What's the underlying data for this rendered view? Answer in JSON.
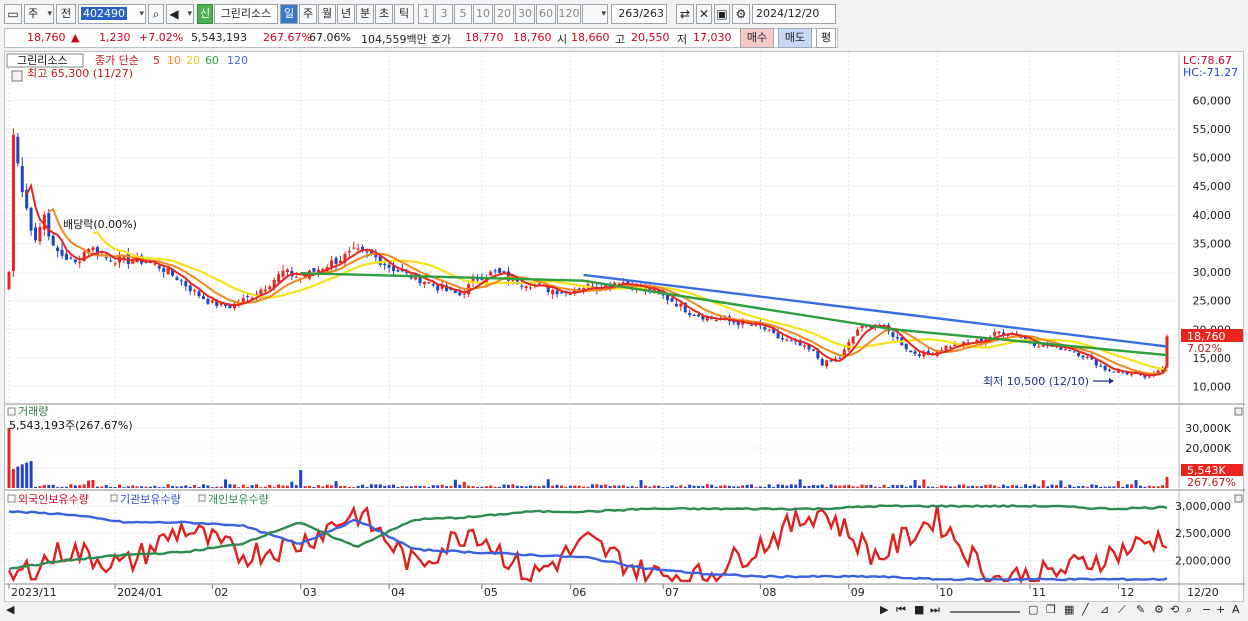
{
  "toolbar": {
    "market": "주",
    "prev": "전",
    "code": "402490",
    "badge": "신",
    "name": "그린리소스",
    "periods": [
      "일",
      "주",
      "월",
      "년",
      "분",
      "초",
      "틱"
    ],
    "active_period": "일",
    "intervals": [
      "1",
      "3",
      "5",
      "10",
      "20",
      "30",
      "60",
      "120"
    ],
    "count": "263",
    "count_total": "/263",
    "date": "2024/12/20"
  },
  "quote": {
    "price": "18,760",
    "direction": "▲",
    "change": "1,230",
    "change_pct": "+7.02%",
    "volume": "5,543,193",
    "volume_ratio": "267.67%",
    "turnover": "67.06%",
    "amount": "104,559백만",
    "ask_label": "호가",
    "ask1": "18,770",
    "ask2": "18,760",
    "open_label": "시",
    "open": "18,660",
    "high_label": "고",
    "high": "20,550",
    "low_label": "저",
    "low": "17,030",
    "buy": "매수",
    "sell": "매도",
    "avg": "평"
  },
  "price_panel": {
    "name_tag": "그린리소스",
    "ma_label": "종가 단순",
    "ma_periods": [
      "5",
      "10",
      "20",
      "60",
      "120"
    ],
    "high_note": "최고 65,300 (11/27)",
    "low_note": "최저 10,500 (12/10)",
    "dividend_note": "배당락(0.00%)",
    "lc": "LC:78.67",
    "hc": "HC:-71.27",
    "last_tag": "18,760",
    "last_pct": "7.02%"
  },
  "volume_panel": {
    "title": "거래량",
    "note": "5,543,193주(267.67%)",
    "last_tag": "5,543K",
    "last_pct": "267.67%"
  },
  "holding_panel": {
    "series_labels": [
      "외국인보유수량",
      "기관보유수량",
      "개인보유수량"
    ]
  },
  "colors": {
    "up": "#e8261f",
    "down": "#1d44c8",
    "ma5": "#e8261f",
    "ma10": "#f08a1c",
    "ma20": "#f5e21a",
    "ma60": "#2e9e3e",
    "ma120": "#3a6de0",
    "foreign": "#e0201c",
    "institution": "#3a62e0",
    "individual": "#2e8a4e"
  },
  "chart_data": [
    {
      "type": "candlestick",
      "title": "그린리소스",
      "y_ticks": [
        "10,000",
        "15,000",
        "20,000",
        "25,000",
        "30,000",
        "35,000",
        "40,000",
        "45,000",
        "50,000",
        "55,000",
        "60,000"
      ],
      "ylim": [
        8000,
        66000
      ],
      "x_ticks": [
        "2023/11",
        "2024/01",
        "02",
        "03",
        "04",
        "05",
        "06",
        "07",
        "08",
        "09",
        "10",
        "11",
        "12",
        "12/20"
      ],
      "close_path": [
        [
          0,
          30000
        ],
        [
          1,
          54000
        ],
        [
          2,
          49000
        ],
        [
          3,
          44000
        ],
        [
          4,
          41000
        ],
        [
          5,
          38000
        ],
        [
          6,
          36000
        ],
        [
          8,
          40000
        ],
        [
          10,
          34000
        ],
        [
          12,
          33000
        ],
        [
          15,
          31500
        ],
        [
          18,
          34500
        ],
        [
          22,
          32500
        ],
        [
          26,
          32000
        ],
        [
          30,
          32000
        ],
        [
          34,
          31000
        ],
        [
          38,
          29000
        ],
        [
          42,
          26500
        ],
        [
          46,
          24500
        ],
        [
          50,
          24000
        ],
        [
          54,
          25500
        ],
        [
          58,
          27500
        ],
        [
          62,
          30000
        ],
        [
          66,
          29000
        ],
        [
          70,
          30500
        ],
        [
          74,
          32000
        ],
        [
          78,
          33500
        ],
        [
          82,
          33000
        ],
        [
          86,
          31000
        ],
        [
          90,
          29500
        ],
        [
          94,
          28500
        ],
        [
          98,
          27000
        ],
        [
          102,
          26000
        ],
        [
          106,
          29000
        ],
        [
          110,
          30000
        ],
        [
          114,
          28500
        ],
        [
          118,
          28000
        ],
        [
          122,
          27000
        ],
        [
          126,
          26500
        ],
        [
          130,
          27500
        ],
        [
          134,
          27500
        ],
        [
          138,
          28500
        ],
        [
          142,
          27500
        ],
        [
          146,
          26500
        ],
        [
          150,
          25000
        ],
        [
          154,
          23000
        ],
        [
          158,
          22000
        ],
        [
          162,
          21500
        ],
        [
          166,
          21000
        ],
        [
          170,
          20500
        ],
        [
          174,
          18500
        ],
        [
          178,
          17500
        ],
        [
          182,
          16000
        ],
        [
          184,
          14000
        ],
        [
          188,
          15000
        ],
        [
          192,
          20000
        ],
        [
          196,
          21000
        ],
        [
          200,
          19000
        ],
        [
          204,
          16000
        ],
        [
          208,
          15500
        ],
        [
          212,
          17000
        ],
        [
          216,
          17500
        ],
        [
          220,
          18000
        ],
        [
          224,
          19500
        ],
        [
          228,
          19000
        ],
        [
          232,
          17500
        ],
        [
          236,
          17000
        ],
        [
          240,
          16500
        ],
        [
          244,
          15000
        ],
        [
          248,
          13000
        ],
        [
          252,
          12500
        ],
        [
          255,
          12000
        ],
        [
          258,
          11500
        ],
        [
          261,
          13500
        ],
        [
          262,
          18760
        ]
      ],
      "ma120_range": [
        [
          130,
          29500
        ],
        [
          262,
          17000
        ]
      ],
      "ma60_range": [
        [
          66,
          29800
        ],
        [
          130,
          28500
        ],
        [
          200,
          20000
        ],
        [
          262,
          15500
        ]
      ]
    },
    {
      "type": "bar",
      "title": "거래량",
      "y_ticks": [
        "10,000K",
        "20,000K",
        "30,000K"
      ],
      "ylim": [
        0,
        38000
      ],
      "last_value": 5543
    },
    {
      "type": "line",
      "title": "외국인보유수량 / 기관보유수량 / 개인보유수량",
      "y_ticks": [
        "2,000,000",
        "2,500,000",
        "3,000,000"
      ],
      "ylim": [
        1600000,
        3150000
      ],
      "series": [
        {
          "name": "외국인보유수량",
          "values": [
            1650000,
            2200000,
            1900000,
            2600000,
            2100000,
            2300000,
            2900000,
            1900000,
            2600000,
            1700000,
            2350000,
            1750000,
            1700000,
            2300000,
            2950000,
            2050000,
            2800000,
            1650000,
            1750000,
            2100000,
            2450000
          ]
        },
        {
          "name": "기관보유수량",
          "values": [
            2900000,
            2850000,
            2700000,
            2700000,
            2650000,
            2300000,
            2750000,
            2200000,
            2150000,
            2100000,
            2050000,
            1850000,
            1750000,
            1700000,
            1700000,
            1700000,
            1650000,
            1650000,
            1650000,
            1650000,
            1650000
          ]
        },
        {
          "name": "개인보유수량",
          "values": [
            1850000,
            2000000,
            2100000,
            2150000,
            2300000,
            2700000,
            2250000,
            2750000,
            2800000,
            2900000,
            2900000,
            2950000,
            2950000,
            2950000,
            2950000,
            3000000,
            3000000,
            3000000,
            3000000,
            2950000,
            2980000
          ]
        }
      ]
    }
  ]
}
